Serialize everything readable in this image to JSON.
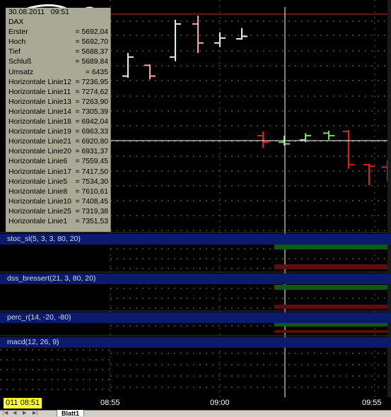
{
  "info_box": {
    "date": "30.08.2011",
    "time": "09:51",
    "symbol": "DAX",
    "rows": [
      {
        "label": "Erster",
        "value": "= 5692,04"
      },
      {
        "label": "Hoch",
        "value": "= 5692,70"
      },
      {
        "label": "Tief",
        "value": "= 5688,37"
      },
      {
        "label": "Schluß",
        "value": "= 5689,84"
      },
      {
        "label": "Umsatz",
        "value": "= 6435"
      },
      {
        "label": "Horizontale Linie12",
        "value": "= 7236,95"
      },
      {
        "label": "Horizontale Linie11",
        "value": "= 7274,62"
      },
      {
        "label": "Horizontale Linie13",
        "value": "= 7263,90"
      },
      {
        "label": "Horizontale Linie14",
        "value": "= 7305,39"
      },
      {
        "label": "Horizontale Linie18",
        "value": "= 6942,04"
      },
      {
        "label": "Horizontale Linie19",
        "value": "= 6963,33"
      },
      {
        "label": "Horizontale Linie21",
        "value": "= 6920,80"
      },
      {
        "label": "Horizontale Linie20",
        "value": "= 6931,37"
      },
      {
        "label": "Horizontale Linie6",
        "value": "= 7559,45"
      },
      {
        "label": "Horizontale Linie17",
        "value": "= 7417,50"
      },
      {
        "label": "Horizontale Linie5",
        "value": "= 7534,30"
      },
      {
        "label": "Horizontale Linie8",
        "value": "= 7610,61"
      },
      {
        "label": "Horizontale Linie10",
        "value": "= 7408,45"
      },
      {
        "label": "Horizontale Linie25",
        "value": "= 7319,38"
      },
      {
        "label": "Horizontale Linie1",
        "value": "= 7351,53"
      }
    ]
  },
  "panels": [
    {
      "label": "stoc_sl(5, 3, 3, 80, 20)"
    },
    {
      "label": "dss_bressert(21, 3, 80, 20)"
    },
    {
      "label": "perc_r(14, -20, -80)"
    },
    {
      "label": "macd(12, 26, 9)"
    }
  ],
  "time_axis": {
    "start_label": "011 08:51",
    "ticks": [
      "08:55",
      "09:00",
      "09:55"
    ]
  },
  "sheet_tab": "Blatt1",
  "colors": {
    "up_bar": "#66e366",
    "down_bar": "#e61e1e",
    "light_up_bar": "#d8f5cc",
    "light_down_bar": "#f5a8a8",
    "panel_header": "#0b1a6b",
    "info_bg": "#a9a996",
    "crosshair": "#ffffff",
    "top_line": "#e02020"
  },
  "chart_data": {
    "type": "ohlc",
    "symbol": "DAX",
    "x_ticks": [
      "08:55",
      "09:00",
      "09:55"
    ],
    "bars": [
      {
        "o": 5620,
        "h": 5640,
        "l": 5600,
        "c": 5630,
        "dir": "up"
      },
      {
        "o": 5630,
        "h": 5652,
        "l": 5624,
        "c": 5645,
        "dir": "up"
      },
      {
        "o": 5645,
        "h": 5646,
        "l": 5628,
        "c": 5632,
        "dir": "down"
      },
      {
        "o": 5632,
        "h": 5660,
        "l": 5630,
        "c": 5655,
        "dir": "up"
      },
      {
        "o": 5655,
        "h": 5700,
        "l": 5650,
        "c": 5695,
        "dir": "up"
      },
      {
        "o": 5695,
        "h": 5705,
        "l": 5660,
        "c": 5672,
        "dir": "down"
      },
      {
        "o": 5672,
        "h": 5685,
        "l": 5667,
        "c": 5678,
        "dir": "up"
      },
      {
        "o": 5677,
        "h": 5690,
        "l": 5676,
        "c": 5680,
        "dir": "up"
      },
      {
        "o": 5560,
        "h": 5565,
        "l": 5545,
        "c": 5552,
        "dir": "down"
      },
      {
        "o": 5552,
        "h": 5560,
        "l": 5548,
        "c": 5550,
        "dir": "up"
      },
      {
        "o": 5555,
        "h": 5563,
        "l": 5552,
        "c": 5560,
        "dir": "up"
      },
      {
        "o": 5563,
        "h": 5566,
        "l": 5555,
        "c": 5560,
        "dir": "up"
      },
      {
        "o": 5565,
        "h": 5567,
        "l": 5520,
        "c": 5525,
        "dir": "down"
      },
      {
        "o": 5525,
        "h": 5526,
        "l": 5500,
        "c": 5523,
        "dir": "down"
      },
      {
        "o": 5522,
        "h": 5530,
        "l": 5505,
        "c": 5511,
        "dir": "down"
      }
    ]
  }
}
